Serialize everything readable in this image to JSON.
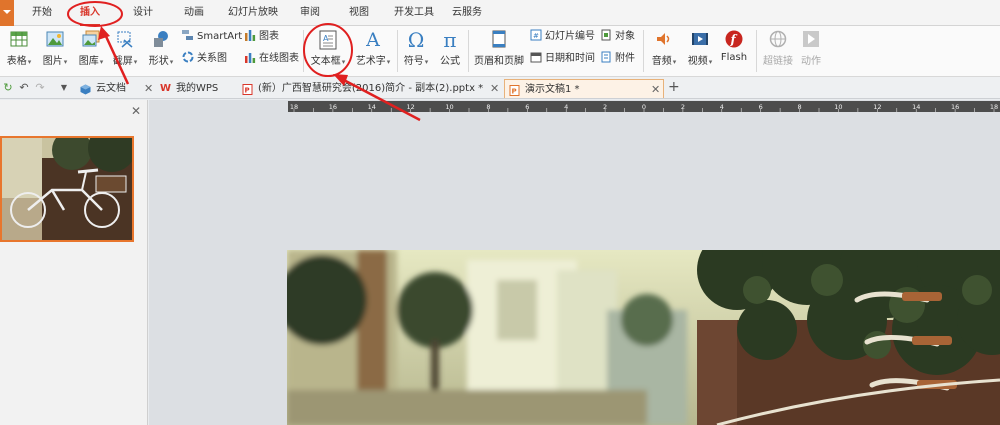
{
  "menu": {
    "tabs": [
      "开始",
      "插入",
      "设计",
      "动画",
      "幻灯片放映",
      "审阅",
      "视图",
      "开发工具",
      "云服务"
    ],
    "active_tab": "插入"
  },
  "ribbon": {
    "table": "表格",
    "picture": "图片",
    "gallery": "图库",
    "screenshot": "截屏",
    "shapes": "形状",
    "smartart": "SmartArt",
    "chart": "图表",
    "relation_chart": "关系图",
    "online_chart": "在线图表",
    "textbox": "文本框",
    "wordart": "艺术字",
    "symbol": "符号",
    "formula": "公式",
    "header_footer": "页眉和页脚",
    "slide_number": "幻灯片编号",
    "object": "对象",
    "date_time": "日期和时间",
    "attachment": "附件",
    "audio": "音频",
    "video": "视频",
    "flash": "Flash",
    "hyperlink": "超链接",
    "action": "动作"
  },
  "doc_tabs": [
    {
      "label": "云文档"
    },
    {
      "label": "我的WPS"
    },
    {
      "label": "(新）广西智慧研究会(2016)简介 - 副本(2).pptx *"
    },
    {
      "label": "演示文稿1 *"
    }
  ],
  "ruler_labels": [
    "18",
    "16",
    "14",
    "12",
    "10",
    "8",
    "6",
    "4",
    "2",
    "0",
    "2",
    "4",
    "6",
    "8",
    "10",
    "12",
    "14",
    "16",
    "18"
  ],
  "colors": {
    "accent_orange": "#e0742c",
    "active_tab_red": "#d9372b",
    "annotation_red": "#e02020"
  },
  "icons": [
    "table-icon",
    "picture-icon",
    "gallery-icon",
    "screenshot-icon",
    "shapes-icon",
    "smartart-icon",
    "chart-icon",
    "relation-chart-icon",
    "online-chart-icon",
    "textbox-icon",
    "wordart-icon",
    "omega-icon",
    "pi-icon",
    "header-footer-icon",
    "slide-number-icon",
    "object-icon",
    "date-time-icon",
    "attachment-icon",
    "audio-icon",
    "video-icon",
    "flash-icon",
    "hyperlink-icon",
    "action-icon"
  ]
}
